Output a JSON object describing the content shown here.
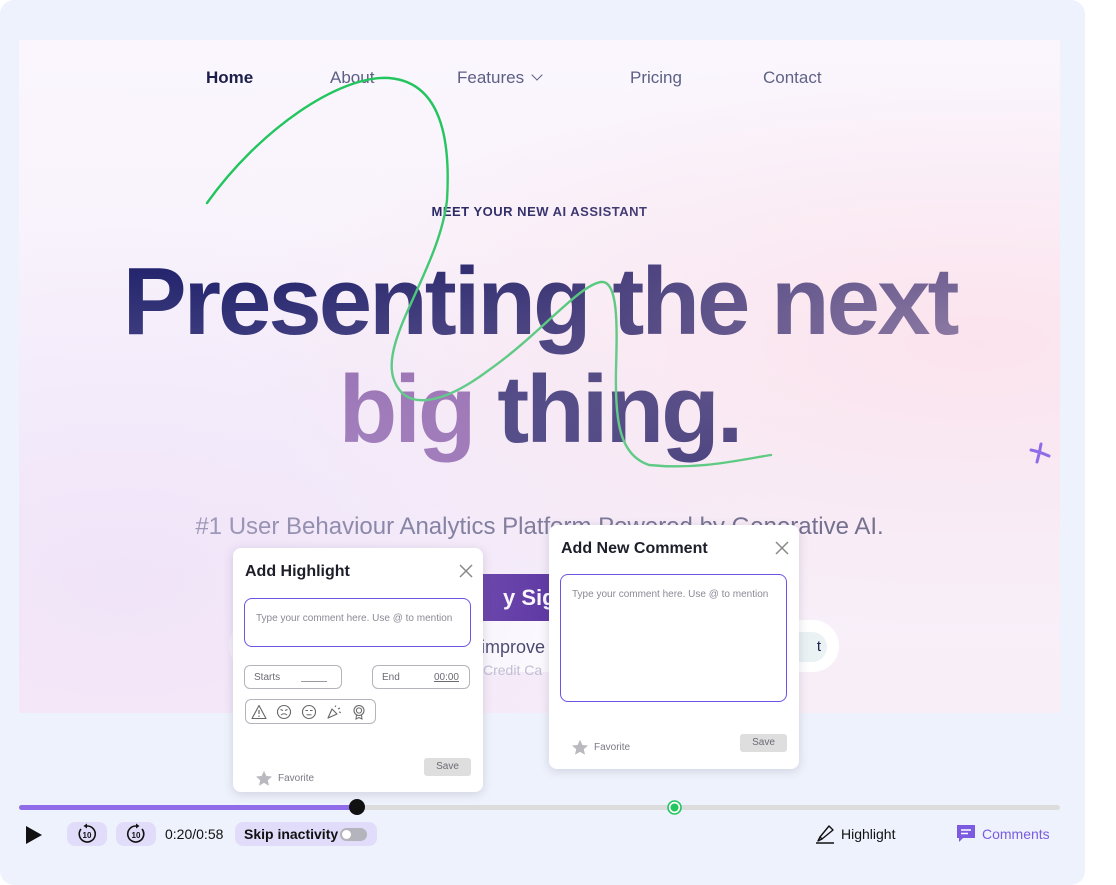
{
  "site": {
    "nav": [
      {
        "label": "Home",
        "active": true
      },
      {
        "label": "About"
      },
      {
        "label": "Features"
      },
      {
        "label": "Pricing"
      },
      {
        "label": "Contact"
      }
    ],
    "eyebrow": "MEET YOUR NEW AI ASSISTANT",
    "headline_line1": "Presenting the next",
    "headline_big": "big",
    "headline_rest": "thing.",
    "subtitle": "#1 User Behaviour Analytics Platform Powered by Generative AI.",
    "cta_partial": "y Sign",
    "input_partial": "improve y",
    "input_button_partial": "t",
    "credit_partial": "Credit Ca"
  },
  "highlight_popup": {
    "title": "Add Highlight",
    "placeholder": "Type your comment here. Use @ to mention",
    "start_label": "Starts",
    "end_label": "End",
    "end_value": "00:00",
    "reactions": [
      "warning-icon",
      "angry-face-icon",
      "annoyed-face-icon",
      "confetti-icon",
      "badge-icon"
    ],
    "favorite_label": "Favorite",
    "save_label": "Save"
  },
  "comment_popup": {
    "title": "Add New Comment",
    "placeholder": "Type your comment here. Use @ to mention",
    "favorite_label": "Favorite",
    "save_label": "Save"
  },
  "player": {
    "time": "0:20/0:58",
    "progress_fraction": 0.325,
    "marker_fraction": 0.629,
    "skip_label": "Skip inactivity",
    "skip_enabled": false,
    "highlight_label": "Highlight",
    "comments_label": "Comments",
    "rewind_seconds": "10",
    "forward_seconds": "10"
  },
  "colors": {
    "accent": "#8f6ce8",
    "marker": "#22c55e",
    "headline": "#0b0e5c",
    "big_word": "#7a4fa0",
    "cta": "#3b0f8e",
    "scribble": "#22c55e"
  }
}
